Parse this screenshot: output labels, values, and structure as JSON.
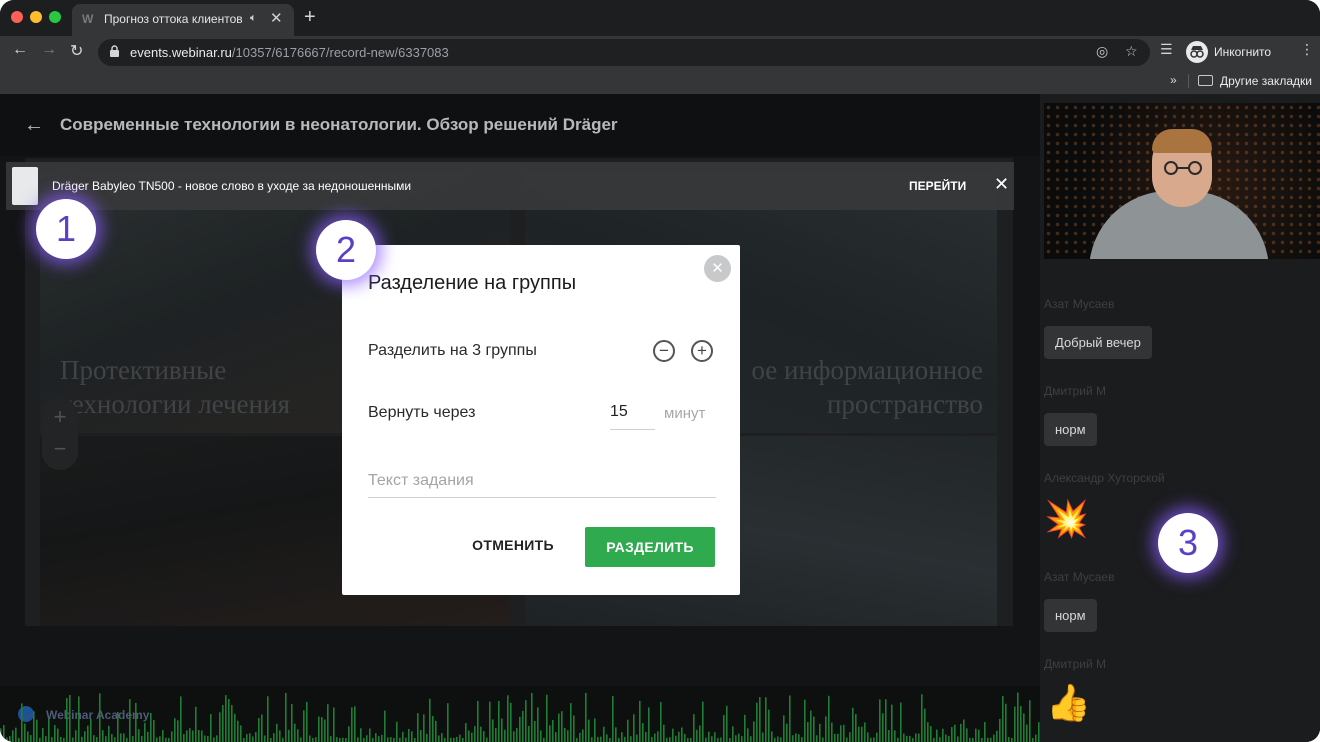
{
  "browser": {
    "tab": {
      "favicon": "W",
      "title": "Прогноз оттока клиентов",
      "audio_icon": "speaker-icon",
      "close": "✕"
    },
    "new_tab": "+",
    "url": {
      "domain": "events.webinar.ru",
      "path": "/10357/6176667/record-new/6337083"
    },
    "profile_label": "Инкогнито",
    "bookmarks": {
      "chevron": "»",
      "other_folder": "Другие закладки"
    }
  },
  "page": {
    "title": "Современные технологии в неонатологии. Обзор решений Dräger",
    "slide_text_left": [
      "Протективные",
      "технологии лечения"
    ],
    "slide_text_right": [
      "ое информационное",
      "пространство"
    ],
    "zoom_in": "+",
    "zoom_out": "−"
  },
  "banner": {
    "text": "Dräger Babyleo TN500 - новое слово в уходе за недоношенными",
    "go_label": "ПЕРЕЙТИ",
    "close": "✕"
  },
  "callouts": {
    "one": "1",
    "two": "2",
    "three": "3"
  },
  "modal": {
    "title": "Разделение на группы",
    "close": "✕",
    "split_label": "Разделить на 3 группы",
    "minus": "−",
    "plus": "+",
    "return_label": "Вернуть через",
    "return_value": "15",
    "return_unit": "минут",
    "task_placeholder": "Текст задания",
    "cancel_label": "ОТМЕНИТЬ",
    "split_button": "РАЗДЕЛИТЬ"
  },
  "chat": {
    "messages": [
      {
        "author": "Азат Мусаев",
        "text": "Добрый вечер"
      },
      {
        "author": "Дмитрий М",
        "text": "норм"
      },
      {
        "author": "Александр Хуторской",
        "emoji": "💥"
      },
      {
        "author": "Азат Мусаев",
        "text": "норм"
      },
      {
        "author": "Дмитрий М",
        "emoji": "👍"
      }
    ]
  },
  "footer": {
    "logo": "Webinar Academy"
  },
  "colors": {
    "accent_green": "#2faa4f",
    "callout_purple": "#5b3fc4"
  }
}
